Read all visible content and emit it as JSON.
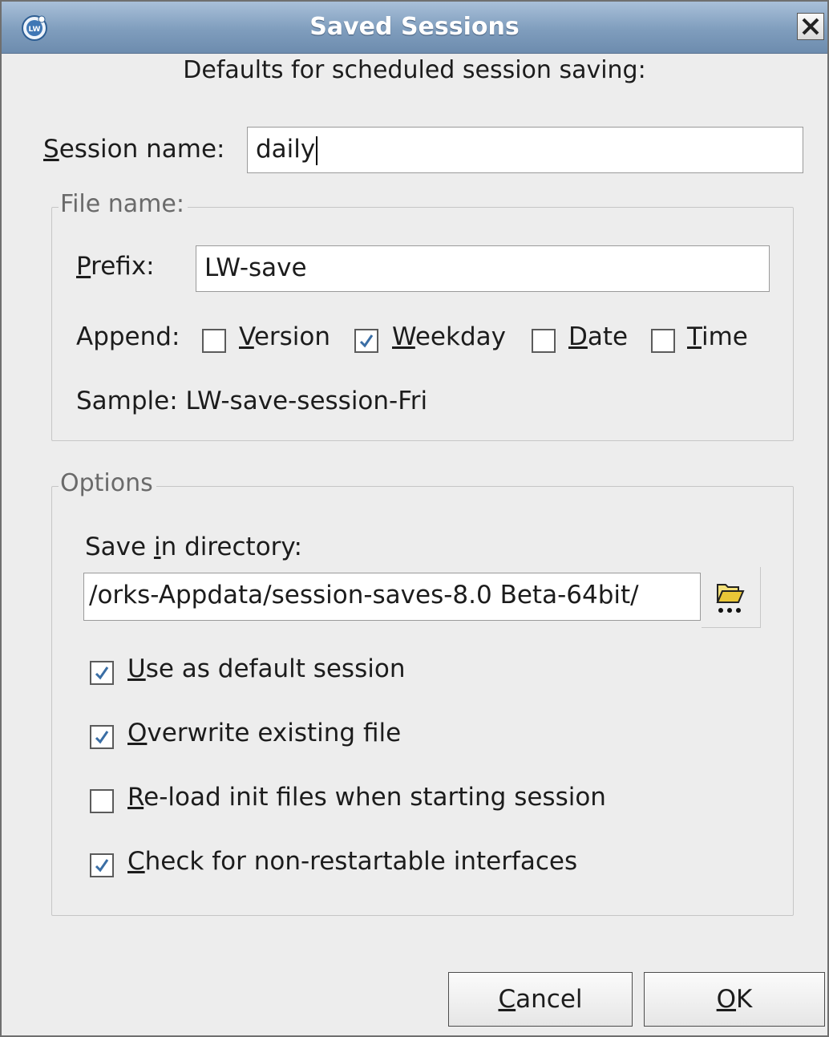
{
  "window": {
    "title": "Saved Sessions",
    "app_icon": "lw-app-icon",
    "close_icon": "close-icon"
  },
  "heading": "Defaults for scheduled session saving:",
  "session": {
    "label_access": "S",
    "label_rest": "ession name:",
    "value": "daily"
  },
  "file_name": {
    "legend": "File name:",
    "prefix": {
      "label_access": "P",
      "label_rest": "refix:",
      "value": "LW-save"
    },
    "append": {
      "label": "Append:",
      "options": [
        {
          "access": "V",
          "rest": "ersion",
          "checked": false
        },
        {
          "access": "W",
          "rest": "eekday",
          "checked": true
        },
        {
          "access": "D",
          "rest": "ate",
          "checked": false
        },
        {
          "access": "T",
          "rest": "ime",
          "checked": false
        }
      ]
    },
    "sample": "Sample: LW-save-session-Fri"
  },
  "options": {
    "legend": "Options",
    "save_dir": {
      "label_pre": "Save ",
      "label_access": "i",
      "label_rest": "n directory:",
      "value": "/orks-Appdata/session-saves-8.0 Beta-64bit/",
      "browse_icon": "folder-open-icon"
    },
    "checks": [
      {
        "access": "U",
        "rest": "se as default session",
        "checked": true
      },
      {
        "access": "O",
        "rest": "verwrite existing file",
        "checked": true
      },
      {
        "access": "R",
        "rest": "e-load init files when starting session",
        "checked": false
      },
      {
        "access": "C",
        "rest": "heck for non-restartable interfaces",
        "checked": true
      }
    ]
  },
  "buttons": {
    "cancel_access": "C",
    "cancel_rest": "ancel",
    "ok_access": "O",
    "ok_rest": "K"
  },
  "colors": {
    "titlebar": "#7f9dbd",
    "checkmark": "#3a6ea5",
    "background": "#ededed"
  }
}
